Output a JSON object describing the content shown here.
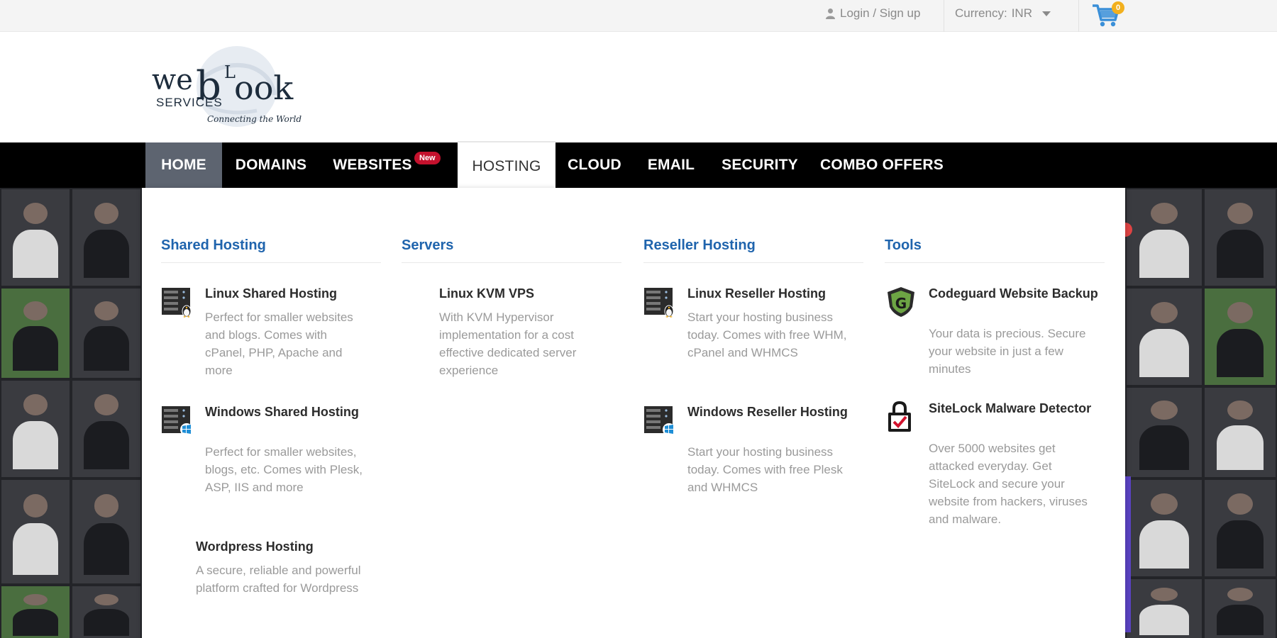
{
  "topbar": {
    "login_label": "Login / Sign up",
    "currency_label": "Currency:",
    "currency_value": "INR",
    "cart_count": "0"
  },
  "logo": {
    "brand_we": "we",
    "brand_b": "b",
    "brand_l": "L",
    "brand_ook": "ook",
    "brand_services": "SERVICES",
    "tagline": "Connecting the World"
  },
  "nav": {
    "items": [
      "HOME",
      "DOMAINS",
      "WEBSITES",
      "HOSTING",
      "CLOUD",
      "EMAIL",
      "SECURITY",
      "COMBO OFFERS"
    ],
    "new_badge": "New",
    "active": "HOME",
    "open": "HOSTING"
  },
  "menu": {
    "shared": {
      "title": "Shared Hosting",
      "items": [
        {
          "title": "Linux Shared Hosting",
          "desc": "Perfect for smaller websites and blogs. Comes with cPanel, PHP, Apache and more",
          "icon": "linux-server-icon"
        },
        {
          "title": "Windows Shared Hosting",
          "desc": "Perfect for smaller websites, blogs, etc. Comes with Plesk, ASP, IIS and more",
          "icon": "windows-server-icon"
        },
        {
          "title": "Wordpress Hosting",
          "desc": "A secure, reliable and powerful platform crafted for Wordpress"
        }
      ]
    },
    "servers": {
      "title": "Servers",
      "items": [
        {
          "title": "Linux KVM VPS",
          "desc": "With KVM Hypervisor implementation for a cost effective dedicated server experience"
        }
      ]
    },
    "reseller": {
      "title": "Reseller Hosting",
      "items": [
        {
          "title": "Linux Reseller Hosting",
          "desc": "Start your hosting business today. Comes with free WHM, cPanel and WHMCS",
          "icon": "linux-server-icon"
        },
        {
          "title": "Windows Reseller Hosting",
          "desc": "Start your hosting business today. Comes with free Plesk and WHMCS",
          "icon": "windows-server-icon"
        }
      ]
    },
    "tools": {
      "title": "Tools",
      "items": [
        {
          "title": "Codeguard Website Backup",
          "desc": "Your data is precious. Secure your website in just a few minutes",
          "icon": "codeguard-shield-icon"
        },
        {
          "title": "SiteLock Malware Detector",
          "desc": "Over 5000 websites get attacked everyday. Get SiteLock and secure your website from hackers, viruses and malware.",
          "icon": "sitelock-padlock-icon"
        }
      ]
    }
  },
  "colors": {
    "nav_bg": "#000000",
    "nav_active": "#5d6470",
    "menu_heading": "#1f64ad",
    "new_badge": "#c4112d",
    "cart": "#3a8fd8",
    "cart_badge": "#f2b01e"
  }
}
